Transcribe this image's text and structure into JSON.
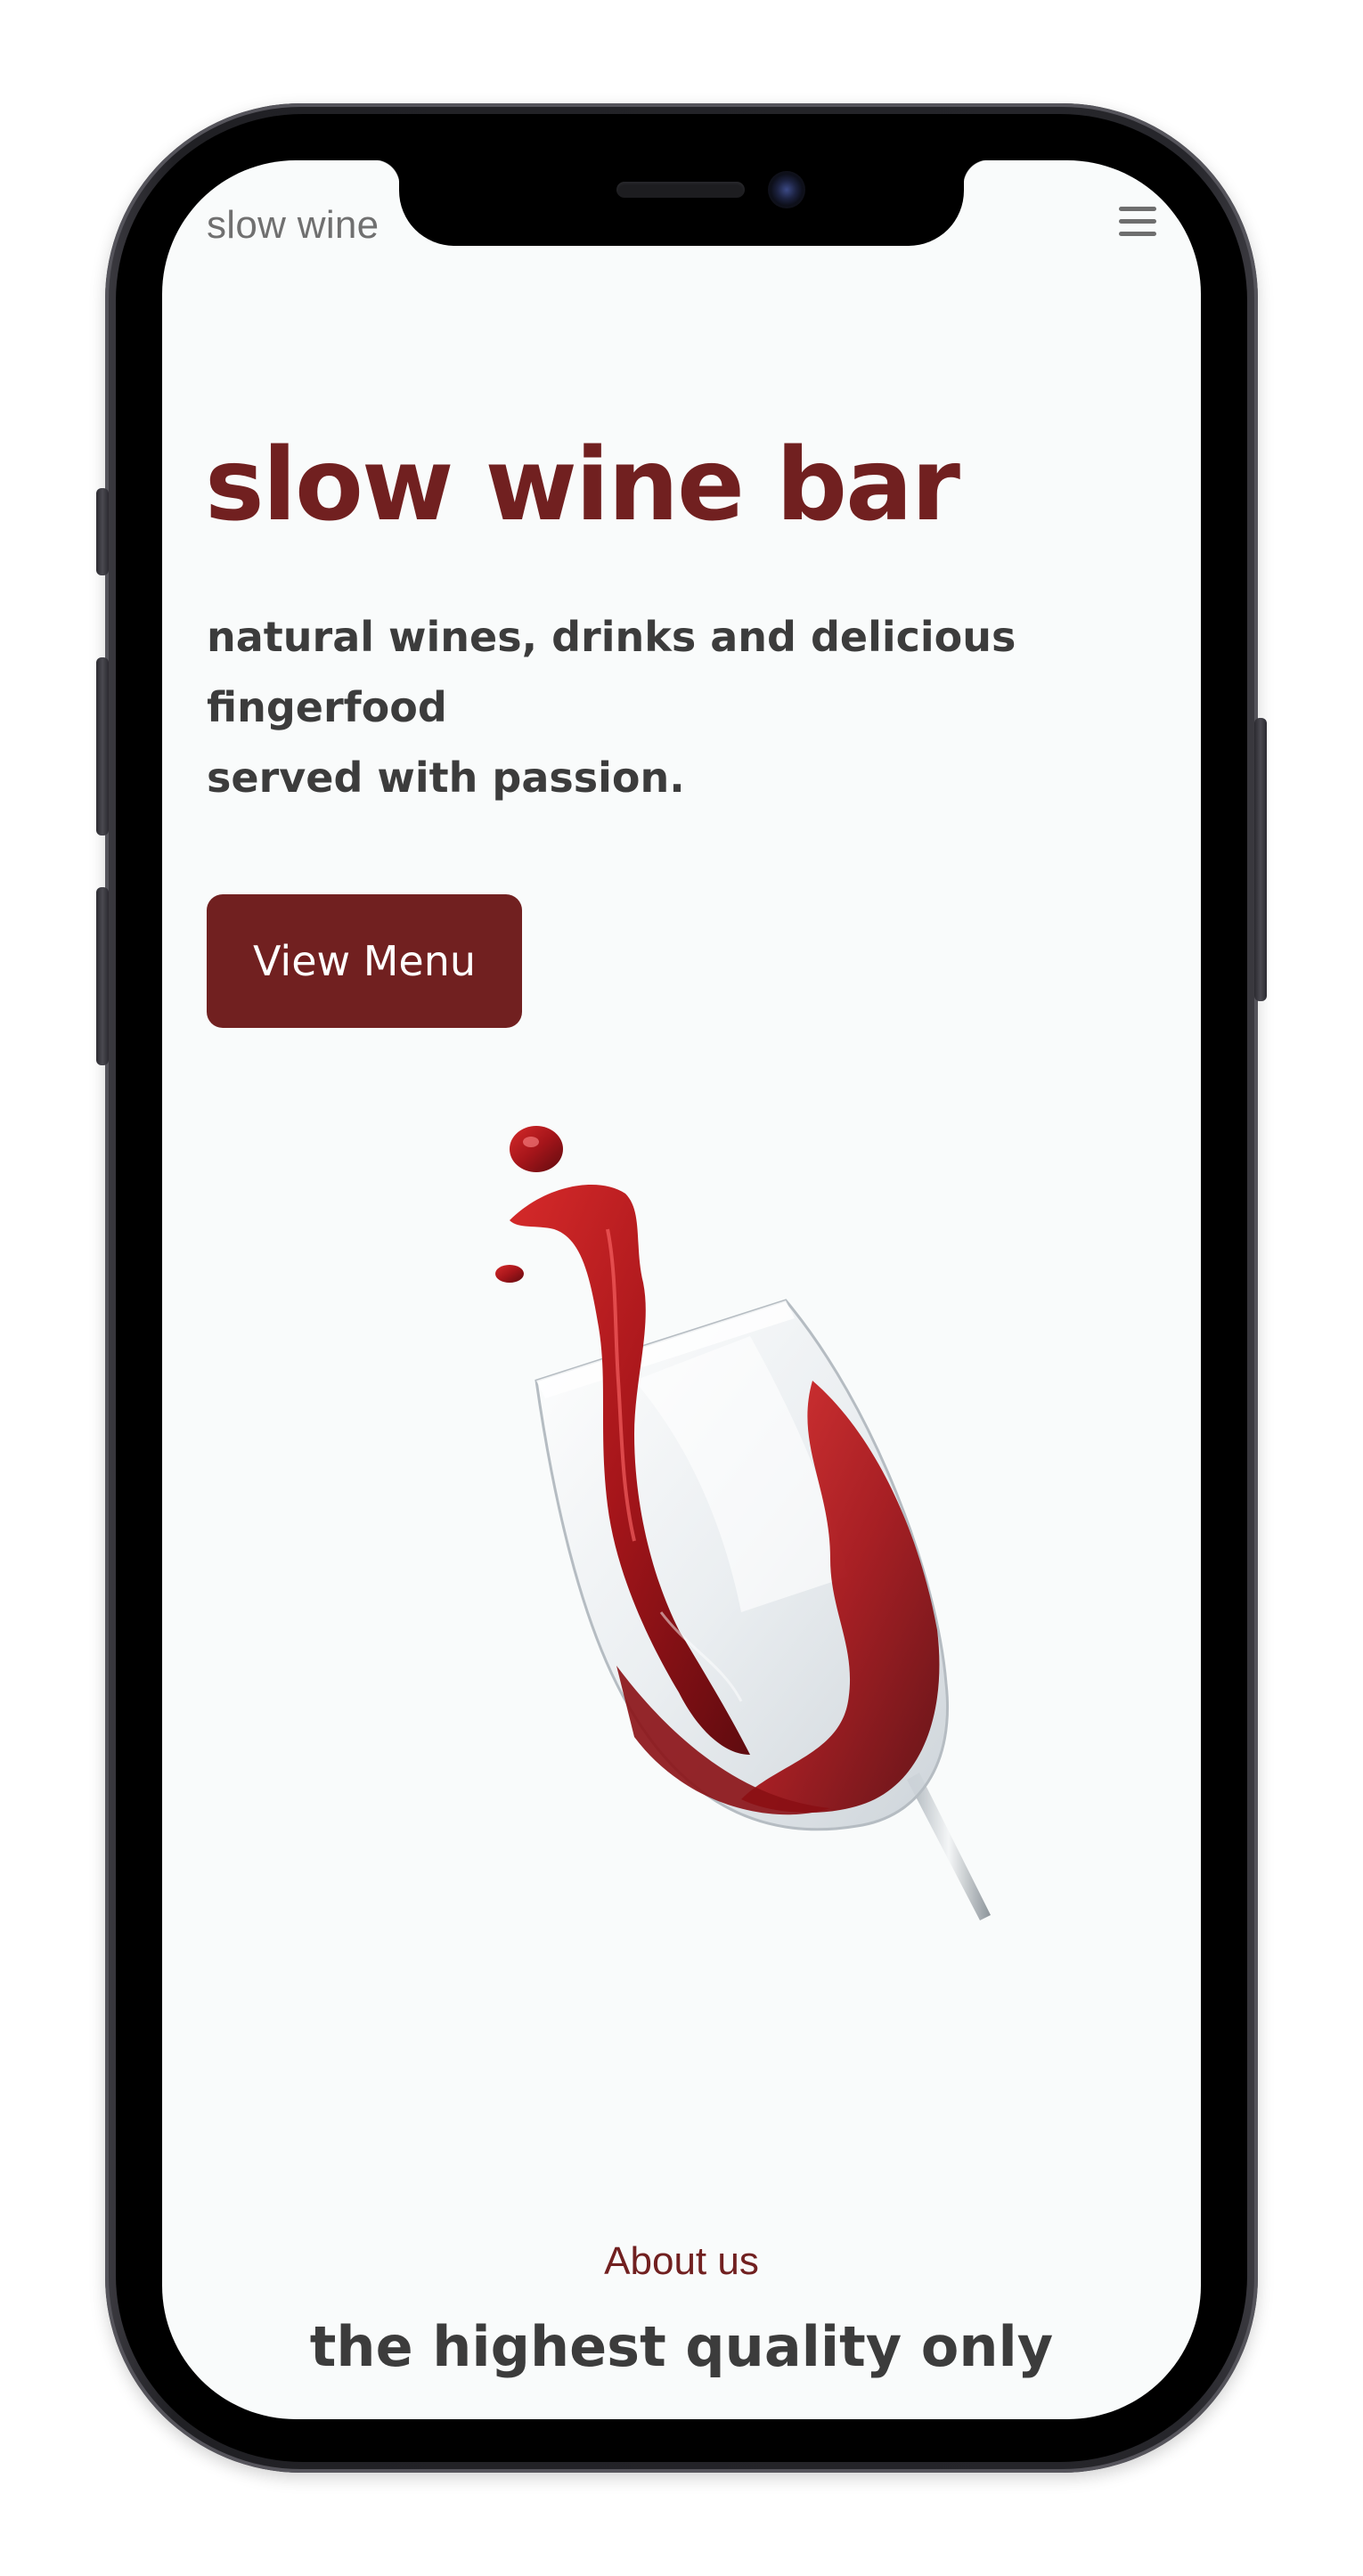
{
  "header": {
    "brand": "slow wine",
    "menu_icon": "hamburger-menu-icon"
  },
  "hero": {
    "title": "slow wine bar",
    "subtitle_lines": [
      "natural wines, drinks and delicious",
      "fingerfood",
      "served with passion."
    ],
    "cta_label": "View Menu",
    "image_subject": "red wine splashing in tilted wine glass"
  },
  "about": {
    "label": "About us",
    "heading": "the highest quality only"
  },
  "colors": {
    "brand": "#712020",
    "text": "#3c3c3c",
    "muted": "#707070",
    "background": "#f9fbfb"
  }
}
